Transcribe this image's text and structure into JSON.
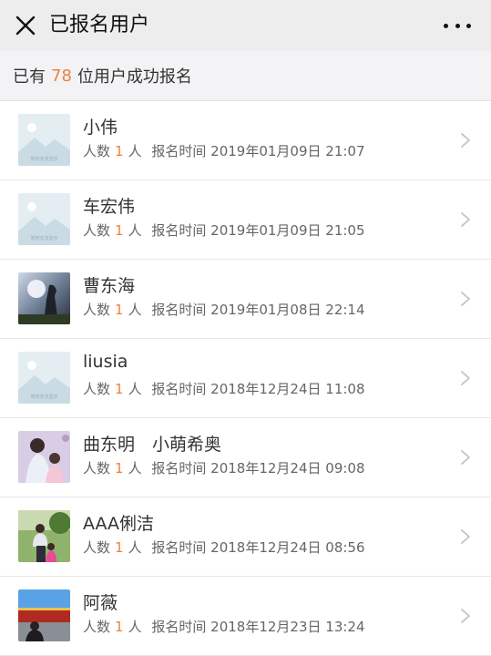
{
  "nav": {
    "title": "已报名用户"
  },
  "summary": {
    "prefix": "已有",
    "count": "78",
    "suffix": "位用户成功报名"
  },
  "labels": {
    "people": "人数",
    "unit": "人",
    "time": "报名时间"
  },
  "placeholder_caption": "暂时无法显示",
  "users": [
    {
      "name": "小伟",
      "count": "1",
      "time": "2019年01月09日 21:07",
      "avatar": "placeholder-icon"
    },
    {
      "name": "车宏伟",
      "count": "1",
      "time": "2019年01月09日 21:05",
      "avatar": "placeholder-icon"
    },
    {
      "name": "曹东海",
      "count": "1",
      "time": "2019年01月08日 22:14",
      "avatar": "photo-silhouette"
    },
    {
      "name": "liusia",
      "count": "1",
      "time": "2018年12月24日 11:08",
      "avatar": "placeholder-icon"
    },
    {
      "name": "曲东明　小萌希奥",
      "count": "1",
      "time": "2018年12月24日 09:08",
      "avatar": "photo-family"
    },
    {
      "name": "AAA俐洁",
      "count": "1",
      "time": "2018年12月24日 08:56",
      "avatar": "photo-outdoor"
    },
    {
      "name": "阿薇",
      "count": "1",
      "time": "2018年12月23日 13:24",
      "avatar": "photo-landmark"
    }
  ]
}
